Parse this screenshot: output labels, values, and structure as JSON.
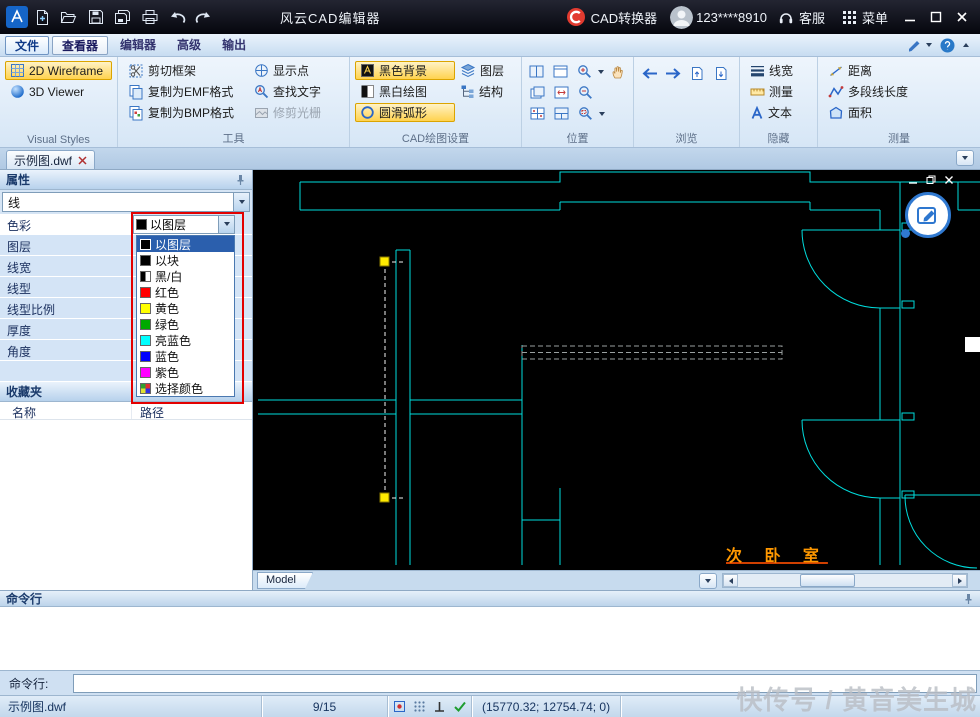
{
  "titlebar": {
    "title": "风云CAD编辑器",
    "converter": "CAD转换器",
    "account": "123****8910",
    "service": "客服",
    "menu": "菜单"
  },
  "menubar": {
    "tabs": [
      "文件",
      "查看器",
      "编辑器",
      "高级",
      "输出"
    ]
  },
  "ribbon": {
    "visual_styles": {
      "label": "Visual Styles",
      "items": [
        "2D Wireframe",
        "3D Viewer"
      ]
    },
    "tools": {
      "label": "工具",
      "items": [
        "剪切框架",
        "复制为EMF格式",
        "复制为BMP格式",
        "显示点",
        "查找文字",
        "修剪光栅"
      ]
    },
    "cad_settings": {
      "label": "CAD绘图设置",
      "items": [
        "黑色背景",
        "黑白绘图",
        "圆滑弧形",
        "图层",
        "结构"
      ]
    },
    "position": {
      "label": "位置"
    },
    "browse": {
      "label": "浏览"
    },
    "hide": {
      "label": "隐藏",
      "items": [
        "线宽",
        "测量",
        "文本"
      ]
    },
    "measure": {
      "label": "测量",
      "items": [
        "距离",
        "多段线长度",
        "面积"
      ]
    }
  },
  "document_tabs": {
    "active": "示例图.dwf"
  },
  "properties": {
    "title": "属性",
    "entity_type": "线",
    "rows": [
      "色彩",
      "图层",
      "线宽",
      "线型",
      "线型比例",
      "厚度",
      "角度"
    ],
    "color_value": "以图层",
    "dropdown": {
      "items": [
        "以图层",
        "以块",
        "黑/白",
        "红色",
        "黄色",
        "绿色",
        "亮蓝色",
        "蓝色",
        "紫色",
        "选择颜色"
      ],
      "swatches": [
        "#000000",
        "#000000",
        "linear-gradient(90deg,#000 50%,#fff 50%)",
        "#ff0000",
        "#ffff00",
        "#00aa00",
        "#00ffff",
        "#0000ff",
        "#ff00ff",
        "conic-gradient(#e03030 0 25%,#3030e0 0 50%,#e0e030 0 75%,#30a030 0)"
      ]
    },
    "favorites_title": "收藏夹",
    "favorites_columns": [
      "名称",
      "路径"
    ]
  },
  "canvas": {
    "room_label": "次 卧 室",
    "model_tab": "Model"
  },
  "command": {
    "panel_title": "命令行",
    "prompt": "命令行:",
    "input_value": ""
  },
  "statusbar": {
    "file": "示例图.dwf",
    "page": "9/15",
    "coords": "(15770.32; 12754.74; 0)"
  },
  "watermark": "快传号 / 黄音美生城",
  "colors": {
    "canvas_line": "#00dcdc",
    "grip": "#ffeb00",
    "room_label": "#ff9800",
    "annotation": "#e30000",
    "highlight": "#ffd24e",
    "selection": "#2b5fad"
  }
}
